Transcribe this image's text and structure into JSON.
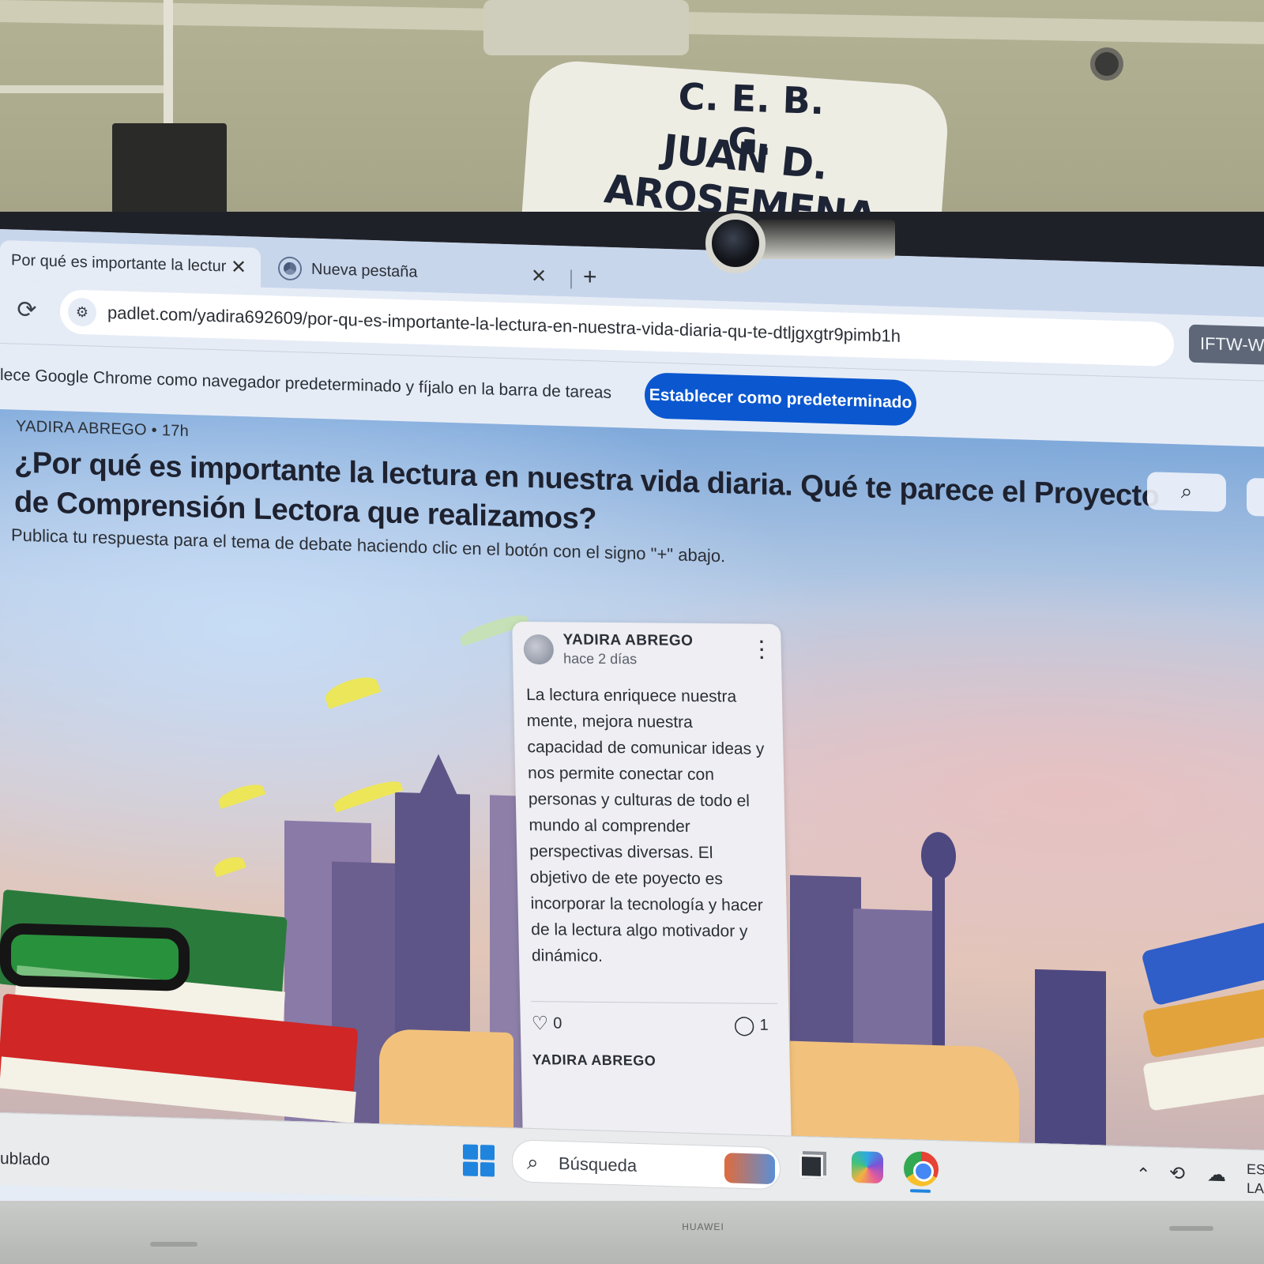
{
  "sign": {
    "line1": "C. E. B. G.",
    "line2": "JUAN D. AROSEMENA"
  },
  "browser": {
    "tabs": [
      {
        "title": "Por qué es importante la lectur",
        "active": true
      },
      {
        "title": "Nueva pestaña",
        "active": false
      }
    ],
    "new_tab_label": "+",
    "close_glyph": "✕",
    "url": "padlet.com/yadira692609/por-qu-es-importante-la-lectura-en-nuestra-vida-diaria-qu-te-dtljgxgtr9pimb1h",
    "profile_chip": "IFTW-W",
    "infobar": {
      "text": "lece Google Chrome como navegador predeterminado y fíjalo en la barra de tareas",
      "button_label": "Establecer como predeterminado"
    }
  },
  "padlet": {
    "author_line": "YADIRA ABREGO • 17h",
    "title": "¿Por qué es importante la lectura en nuestra vida diaria. Qué te parece el Proyecto de Comprensión Lectora que realizamos?",
    "description": "Publica tu respuesta para el tema de debate haciendo clic en el botón con el signo \"+\" abajo.",
    "post": {
      "author": "YADIRA ABREGO",
      "time": "hace 2 días",
      "body": "La lectura enriquece nuestra mente, mejora nuestra capacidad de comunicar ideas y nos permite conectar con personas y culturas de todo el mundo al comprender perspectivas diversas. El objetivo de ete poyecto es incorporar la tecnología y hacer de la lectura algo motivador y dinámico.",
      "likes": "0",
      "comments": "1",
      "comment_preview_author": "YADIRA ABREGO"
    }
  },
  "taskbar": {
    "weather": "ublado",
    "search_label": "Búsqueda",
    "lang_line1": "ES",
    "lang_line2": "LA"
  },
  "monitor": {
    "brand": "HUAWEI"
  },
  "icons": {
    "reload": "reload-icon",
    "site_info": "tune-icon",
    "search": "search-icon",
    "more": "more-vertical-icon",
    "like": "heart-icon",
    "comment": "comment-icon",
    "windows": "windows-icon",
    "chrome": "chrome-icon"
  },
  "colors": {
    "primary_button": "#0b57d0",
    "tab_bar": "#c8d6ec",
    "toolbar": "#e6ecf6"
  }
}
